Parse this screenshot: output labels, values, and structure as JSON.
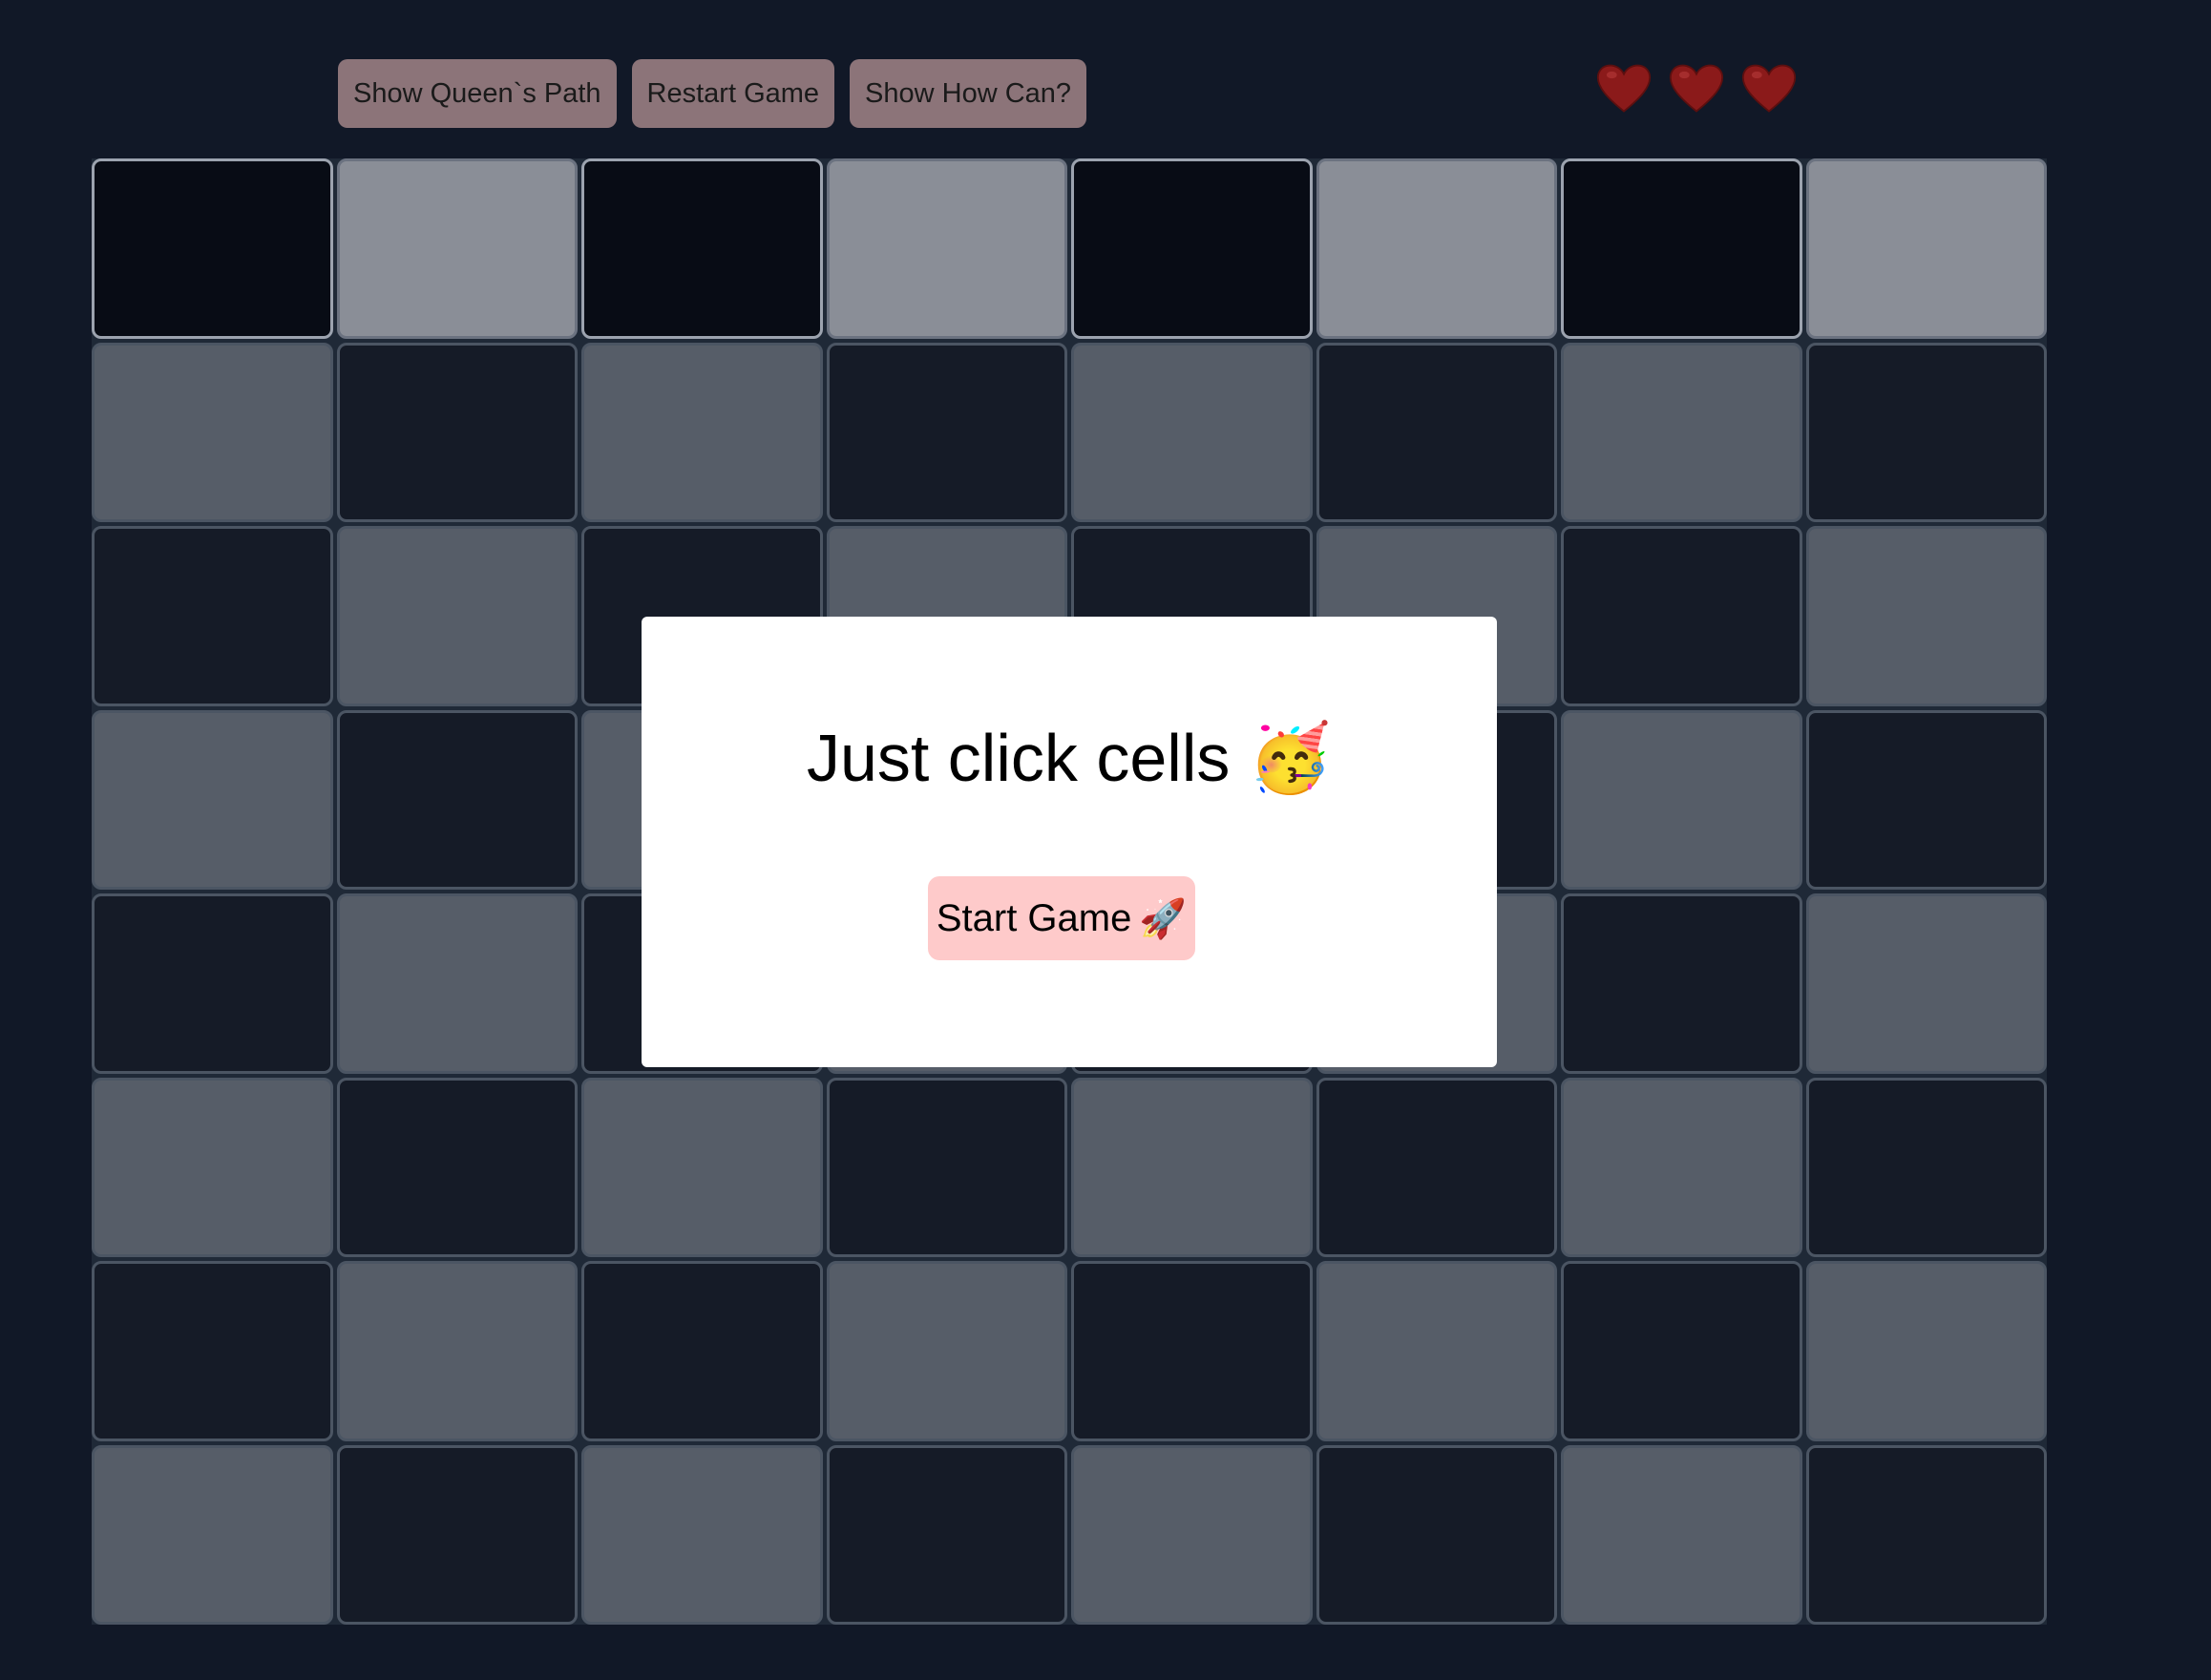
{
  "toolbar": {
    "show_path_label": "Show Queen`s Path",
    "restart_label": "Restart Game",
    "show_how_label": "Show How Can?"
  },
  "lives": {
    "count": 3,
    "icon": "heart-icon",
    "color": "#8b1a1a"
  },
  "board": {
    "rows": 8,
    "cols": 8
  },
  "modal": {
    "title": "Just click cells",
    "title_emoji": "🥳",
    "start_label": "Start Game",
    "start_emoji": "🚀"
  },
  "colors": {
    "background": "#111827",
    "button": "#8c7479",
    "start_button": "#fecaca",
    "cell_light": "#565d68",
    "cell_dark": "#151b27"
  }
}
